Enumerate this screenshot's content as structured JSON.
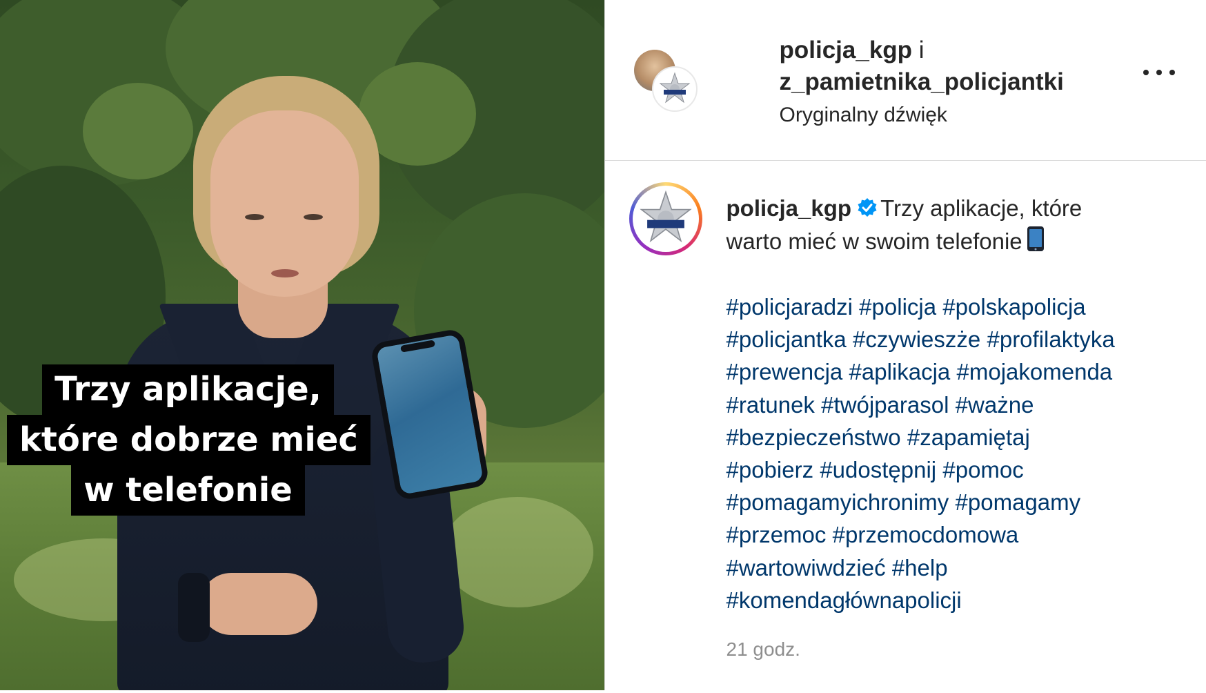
{
  "video": {
    "overlay_caption": [
      "Trzy aplikacje,",
      "które dobrze mieć",
      "w telefonie"
    ]
  },
  "header": {
    "user_primary": "policja_kgp",
    "conjunction": "i",
    "user_secondary": "z_pamietnika_policjantki",
    "audio": "Oryginalny dźwięk",
    "more_icon": "more-horizontal-icon"
  },
  "post": {
    "author": "policja_kgp",
    "verified_icon": "verified-badge-icon",
    "caption_line1": "Trzy aplikacje, które",
    "caption_line2": "warto mieć w swoim telefonie",
    "caption_emoji": "mobile-phone-icon",
    "hashtags": [
      "#policjaradzi",
      "#policja",
      "#polskapolicja",
      "#policjantka",
      "#czywieszże",
      "#profilaktyka",
      "#prewencja",
      "#aplikacja",
      "#mojakomenda",
      "#ratunek",
      "#twójparasol",
      "#ważne",
      "#bezpieczeństwo",
      "#zapamiętaj",
      "#pobierz",
      "#udostępnij",
      "#pomoc",
      "#pomagamyichronimy",
      "#pomagamy",
      "#przemoc",
      "#przemocdomowa",
      "#wartowiwdzieć",
      "#help",
      "#komendagłównapolicji"
    ],
    "timestamp": "21 godz."
  },
  "colors": {
    "hashtag": "#00376b",
    "text": "#262626",
    "muted": "#8e8e8e",
    "verified": "#0095f6"
  }
}
